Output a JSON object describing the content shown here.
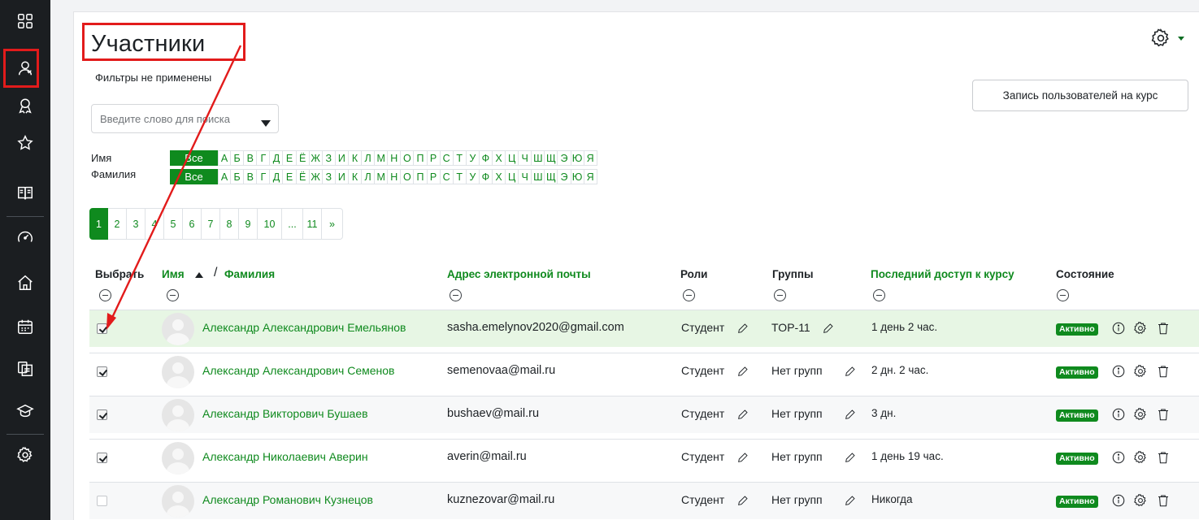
{
  "page": {
    "title": "Участники",
    "filters_status": "Фильтры не применены",
    "enrol_button": "Запись пользователей на курс",
    "search_placeholder": "Введите слово для поиска"
  },
  "sidebar": {
    "items": [
      {
        "icon": "dashboard-grid-icon"
      },
      {
        "icon": "participants-icon",
        "highlighted": true
      },
      {
        "icon": "badges-icon"
      },
      {
        "icon": "star-icon"
      },
      {
        "icon": "gradebook-icon"
      },
      {
        "icon": "dashboard-gauge-icon"
      },
      {
        "icon": "home-icon"
      },
      {
        "icon": "calendar-icon"
      },
      {
        "icon": "files-icon"
      },
      {
        "icon": "graduation-cap-icon"
      },
      {
        "icon": "admin-gear-icon"
      }
    ]
  },
  "filters": {
    "first_name_label": "Имя",
    "last_name_label": "Фамилия",
    "all_label": "Все",
    "letters": [
      "А",
      "Б",
      "В",
      "Г",
      "Д",
      "Е",
      "Ё",
      "Ж",
      "З",
      "И",
      "К",
      "Л",
      "М",
      "Н",
      "О",
      "П",
      "Р",
      "С",
      "Т",
      "У",
      "Ф",
      "Х",
      "Ц",
      "Ч",
      "Ш",
      "Щ",
      "Э",
      "Ю",
      "Я"
    ]
  },
  "pagination": {
    "pages": [
      "1",
      "2",
      "3",
      "4",
      "5",
      "6",
      "7",
      "8",
      "9",
      "10",
      "...",
      "11",
      "»"
    ],
    "current": "1"
  },
  "table": {
    "headers": {
      "select": "Выбрать",
      "first_name": "Имя",
      "separator": "/",
      "last_name": "Фамилия",
      "email": "Адрес электронной почты",
      "roles": "Роли",
      "groups": "Группы",
      "last_access": "Последний доступ к курсу",
      "status": "Состояние"
    },
    "rows": [
      {
        "selected": true,
        "name": "Александр Александрович Емельянов",
        "email": "sasha.emelynov2020@gmail.com",
        "role": "Студент",
        "group": "TOP-11",
        "last_access": "1 день 2 час.",
        "status": "Активно"
      },
      {
        "selected": true,
        "name": "Александр Александрович Семенов",
        "email": "semenovaa@mail.ru",
        "role": "Студент",
        "group": "Нет групп",
        "last_access": "2 дн. 2 час.",
        "status": "Активно"
      },
      {
        "selected": true,
        "name": "Александр Викторович Бушаев",
        "email": "bushaev@mail.ru",
        "role": "Студент",
        "group": "Нет групп",
        "last_access": "3 дн.",
        "status": "Активно"
      },
      {
        "selected": true,
        "name": "Александр Николаевич Аверин",
        "email": "averin@mail.ru",
        "role": "Студент",
        "group": "Нет групп",
        "last_access": "1 день 19 час.",
        "status": "Активно"
      },
      {
        "selected": false,
        "name": "Александр Романович Кузнецов",
        "email": "kuznezovar@mail.ru",
        "role": "Студент",
        "group": "Нет групп",
        "last_access": "Никогда",
        "status": "Активно"
      }
    ]
  },
  "colors": {
    "accent_green": "#0f8a1e",
    "sidebar_bg": "#1b1e21",
    "annotation_red": "#e21b1b",
    "highlight_row": "#e7f6e4"
  }
}
